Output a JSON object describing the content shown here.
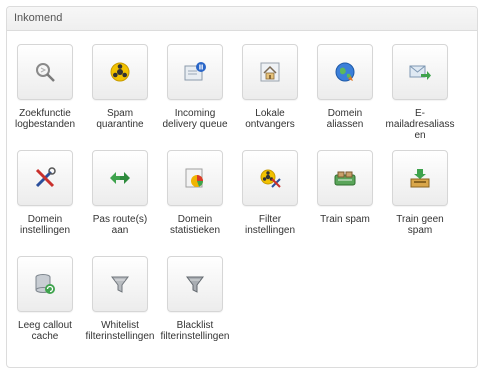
{
  "panel": {
    "title": "Inkomend"
  },
  "tiles": [
    {
      "label": "Zoekfunctie logbestanden"
    },
    {
      "label": "Spam quarantine"
    },
    {
      "label": "Incoming delivery queue"
    },
    {
      "label": "Lokale ontvangers"
    },
    {
      "label": "Domein aliassen"
    },
    {
      "label": "E-mailadresaliassen"
    },
    {
      "label": "Domein instellingen"
    },
    {
      "label": "Pas route(s) aan"
    },
    {
      "label": "Domein statistieken"
    },
    {
      "label": "Filter instellingen"
    },
    {
      "label": "Train spam"
    },
    {
      "label": "Train geen spam"
    },
    {
      "label": "Leeg callout cache"
    },
    {
      "label": "Whitelist filterinstellingen"
    },
    {
      "label": "Blacklist filterinstellingen"
    }
  ]
}
